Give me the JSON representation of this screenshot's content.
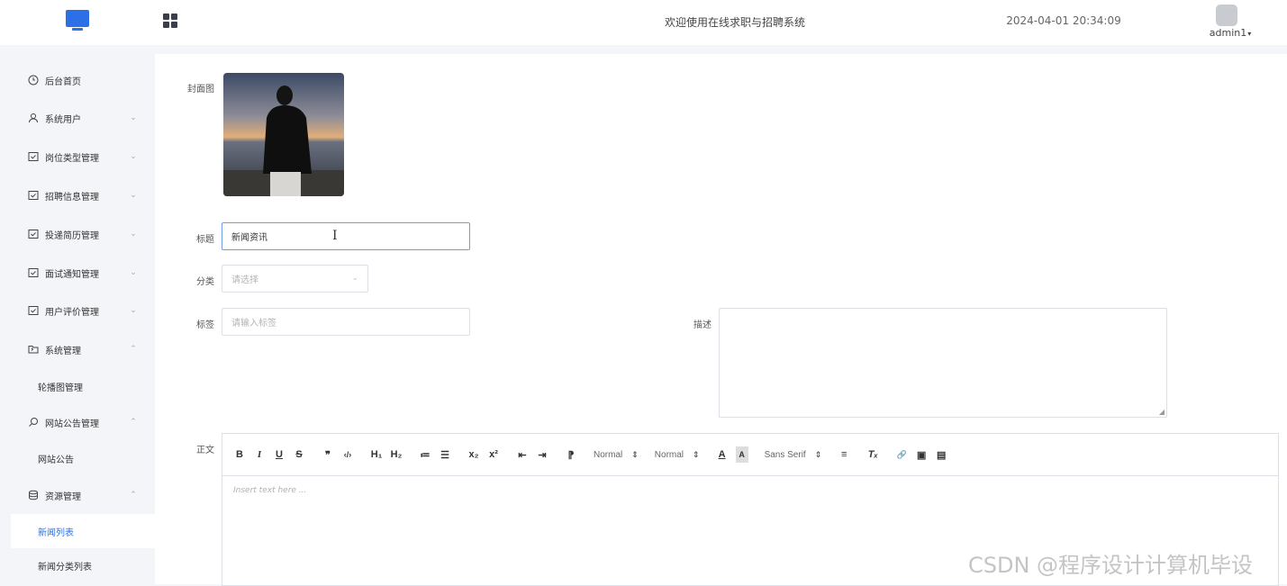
{
  "header": {
    "welcome": "欢迎使用在线求职与招聘系统",
    "datetime": "2024-04-01 20:34:09",
    "user": "admin1",
    "icons": {
      "logo": "monitor-icon",
      "menu": "grid-icon",
      "avatar": "avatar"
    }
  },
  "sidebar": {
    "items": [
      {
        "label": "后台首页",
        "icon": "clock-icon",
        "arrow": ""
      },
      {
        "label": "系统用户",
        "icon": "user-icon",
        "arrow": "⌄"
      },
      {
        "label": "岗位类型管理",
        "icon": "checkbox-icon",
        "arrow": "⌄"
      },
      {
        "label": "招聘信息管理",
        "icon": "checkbox-icon",
        "arrow": "⌄"
      },
      {
        "label": "投递简历管理",
        "icon": "checkbox-icon",
        "arrow": "⌄"
      },
      {
        "label": "面试通知管理",
        "icon": "checkbox-icon",
        "arrow": "⌄"
      },
      {
        "label": "用户评价管理",
        "icon": "checkbox-icon",
        "arrow": "⌄"
      },
      {
        "label": "系统管理",
        "icon": "folder-icon",
        "arrow": "⌃"
      },
      {
        "label": "网站公告管理",
        "icon": "search-icon",
        "arrow": "⌃"
      },
      {
        "label": "资源管理",
        "icon": "database-icon",
        "arrow": "⌃"
      }
    ],
    "subitems": {
      "system": [
        "轮播图管理"
      ],
      "notice": [
        "网站公告"
      ],
      "resource": [
        "新闻列表",
        "新闻分类列表"
      ]
    },
    "active": "新闻列表"
  },
  "form": {
    "cover_label": "封面图",
    "title_label": "标题",
    "title_value": "新闻资讯",
    "category_label": "分类",
    "category_placeholder": "请选择",
    "tags_label": "标签",
    "tags_placeholder": "请输入标签",
    "desc_label": "描述",
    "body_label": "正文"
  },
  "editor": {
    "toolbar": {
      "bold": "B",
      "italic": "I",
      "underline": "U",
      "strike": "S",
      "quote": "❞",
      "code": "‹/›",
      "h1": "H₁",
      "h2": "H₂",
      "ordered_list": "≔",
      "bullet_list": "☰",
      "subscript": "x₂",
      "superscript": "x²",
      "outdent": "⇤",
      "indent": "⇥",
      "direction": "⁋",
      "size": "Normal",
      "header": "Normal",
      "color": "A",
      "background": "A",
      "font": "Sans Serif",
      "align": "≡",
      "clean": "Tₓ",
      "link": "🔗",
      "image": "▣",
      "video": "▤"
    },
    "placeholder": "Insert text here ..."
  },
  "watermark": "CSDN @程序设计计算机毕设",
  "colors": {
    "accent": "#2d6fe6",
    "sidebar_bg": "#f3f5f9",
    "border": "#dcdfe6"
  }
}
